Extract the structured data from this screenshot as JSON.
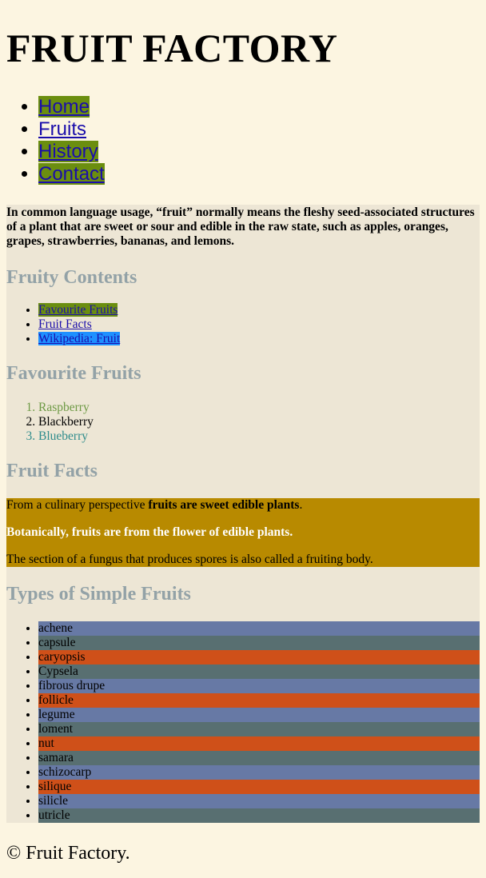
{
  "header": {
    "title": "FRUIT FACTORY"
  },
  "nav": [
    {
      "label": "Home",
      "highlight": true
    },
    {
      "label": "Fruits",
      "highlight": false
    },
    {
      "label": "History",
      "highlight": true
    },
    {
      "label": "Contact",
      "highlight": true
    }
  ],
  "intro": "In common language usage, “fruit” normally means the fleshy seed-associated structures of a plant that are sweet or sour and edible in the raw state, such as apples, oranges, grapes, strawberries, bananas, and lemons.",
  "contents": {
    "heading": "Fruity Contents",
    "links": [
      "Favourite Fruits",
      "Fruit Facts",
      "Wikipedia: Fruit"
    ]
  },
  "favourites": {
    "heading": "Favourite Fruits",
    "items": [
      "Raspberry",
      "Blackberry",
      "Blueberry"
    ]
  },
  "facts": {
    "heading": "Fruit Facts",
    "p1_prefix": "From a culinary perspective ",
    "p1_bold": "fruits are sweet edible plants",
    "p1_suffix": ".",
    "p2": "Botanically, fruits are from the flower of edible plants.",
    "p3": "The section of a fungus that produces spores is also called a fruiting body."
  },
  "types": {
    "heading": "Types of Simple Fruits",
    "items": [
      "achene",
      "capsule",
      "caryopsis",
      "Cypsela",
      "fibrous drupe",
      "follicle",
      "legume",
      "loment",
      "nut",
      "samara",
      "schizocarp",
      "silique",
      "silicle",
      "utricle"
    ]
  },
  "footer": "© Fruit Factory.",
  "colors": {
    "page_bg": "#fcf5e1",
    "main_bg": "#ede6d5",
    "nav_highlight": "#6b8e0f",
    "link_blue_bg": "#1e90ff",
    "heading": "#93a2a7",
    "facts_bg": "#b88a00",
    "row_blue": "#6779a5",
    "row_slate": "#586f71",
    "row_orange": "#cf5019"
  }
}
